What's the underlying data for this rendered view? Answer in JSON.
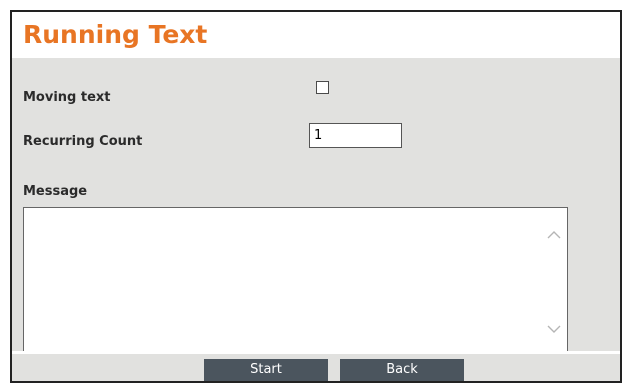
{
  "page": {
    "title": "Running Text"
  },
  "form": {
    "moving_text": {
      "label": "Moving text",
      "checked": false
    },
    "recurring_count": {
      "label": "Recurring Count",
      "value": "1"
    },
    "message": {
      "label": "Message",
      "value": ""
    }
  },
  "actions": {
    "start_label": "Start",
    "back_label": "Back"
  },
  "colors": {
    "title": "#e87524",
    "panel": "#e1e1df",
    "button": "#4b555e"
  },
  "icons": {
    "scroll_up": "chevron-up-icon",
    "scroll_down": "chevron-down-icon"
  }
}
